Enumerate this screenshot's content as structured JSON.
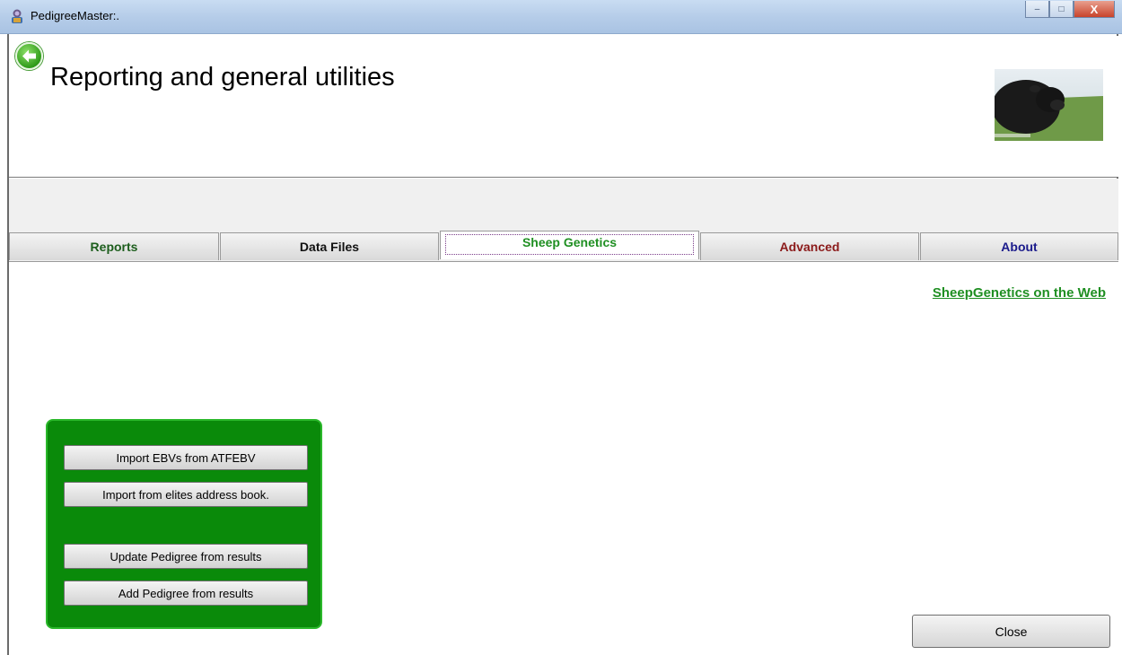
{
  "window": {
    "title": "PedigreeMaster:.",
    "minimize": "–",
    "maximize": "□",
    "close": "X"
  },
  "header": {
    "title": "Reporting and general utilities"
  },
  "tabs": [
    {
      "label": "Reports",
      "color": "#1d5e1d"
    },
    {
      "label": "Data Files",
      "color": "#111111"
    },
    {
      "label": "Sheep Genetics",
      "color": "#1f8f22",
      "active": true
    },
    {
      "label": "Advanced",
      "color": "#8b1a1a"
    },
    {
      "label": "About",
      "color": "#1a1a8b"
    }
  ],
  "content": {
    "web_link": "SheepGenetics on the Web",
    "buttons": {
      "import_ebvs": "Import EBVs from ATFEBV",
      "import_elites": "Import from elites address book.",
      "update_pedigree": "Update Pedigree from results",
      "add_pedigree": "Add Pedigree from results"
    },
    "close": "Close"
  },
  "colors": {
    "panel_green": "#0a8a0a",
    "link_green": "#1f8f22"
  },
  "icons": {
    "back": "back-arrow-icon",
    "app": "app-icon"
  }
}
